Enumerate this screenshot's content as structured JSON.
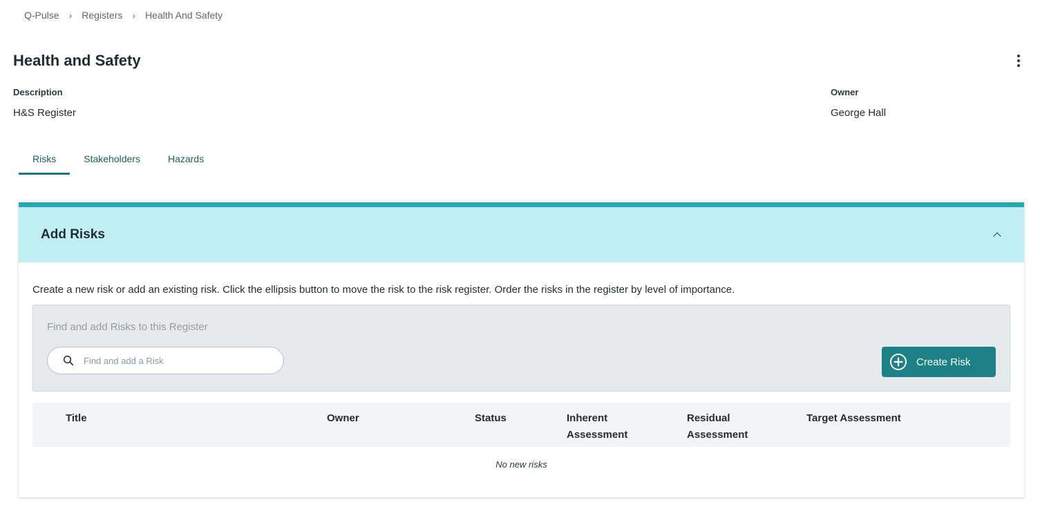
{
  "breadcrumb": [
    "Q-Pulse",
    "Registers",
    "Health And Safety"
  ],
  "page": {
    "title": "Health and Safety"
  },
  "fields": {
    "description_label": "Description",
    "description_value": "H&S Register",
    "owner_label": "Owner",
    "owner_value": "George Hall"
  },
  "tabs": [
    {
      "label": "Risks",
      "active": true
    },
    {
      "label": "Stakeholders",
      "active": false
    },
    {
      "label": "Hazards",
      "active": false
    }
  ],
  "panel": {
    "title": "Add Risks",
    "description": "Create a new risk or add an existing risk. Click the ellipsis button to move the risk to the risk register. Order the risks in the register by level of importance.",
    "find_heading": "Find and add Risks to this Register",
    "search_placeholder": "Find and add a Risk",
    "create_button": "Create Risk",
    "columns": [
      "Title",
      "Owner",
      "Status",
      "Inherent Assessment",
      "Residual Assessment",
      "Target Assessment"
    ],
    "empty_message": "No new risks"
  },
  "colors": {
    "accent": "#25a8b0",
    "header_bg": "#c0eff3",
    "button": "#1c8185"
  },
  "icons": [
    "chevron-right-icon",
    "kebab-menu-icon",
    "chevron-up-icon",
    "search-icon",
    "plus-circle-icon"
  ]
}
